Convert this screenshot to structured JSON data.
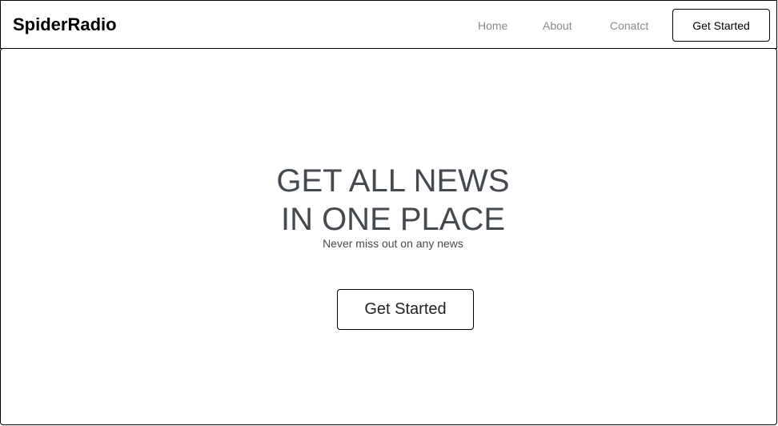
{
  "navbar": {
    "brand": "SpiderRadio",
    "links": [
      {
        "label": "Home"
      },
      {
        "label": "About"
      },
      {
        "label": "Conatct"
      }
    ],
    "cta_label": "Get Started"
  },
  "hero": {
    "title_line1": "GET ALL NEWS",
    "title_line2": "IN ONE PLACE",
    "subtitle": "Never miss out on any news",
    "cta_label": "Get Started"
  },
  "colors": {
    "heading_text": "#444a4f",
    "nav_link_text": "#8a8a8a",
    "border": "#000000",
    "background": "#ffffff"
  }
}
